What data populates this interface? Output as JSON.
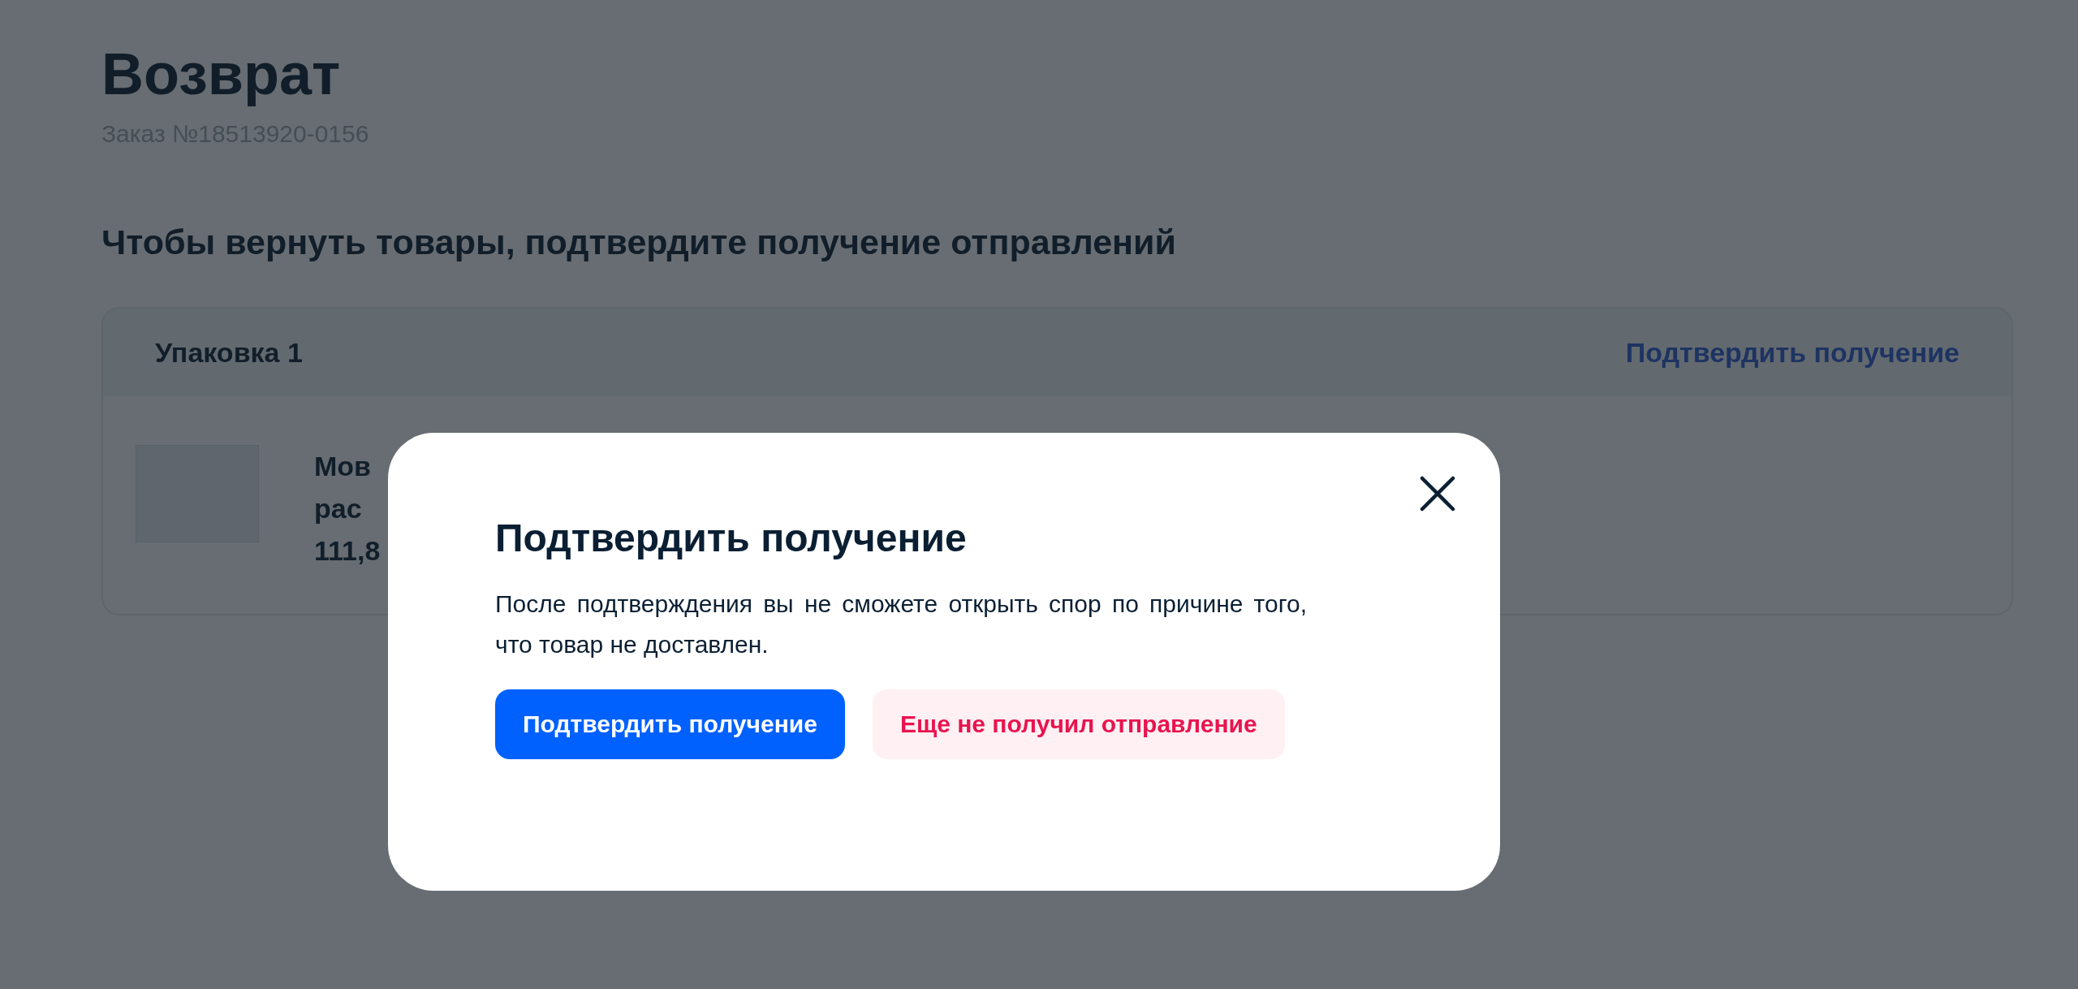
{
  "page": {
    "title": "Возврат",
    "order_number": "Заказ №18513920-0156",
    "subtitle": "Чтобы вернуть товары, подтвердите получение отправлений"
  },
  "package": {
    "title": "Упаковка 1",
    "action": "Подтвердить получение",
    "product": {
      "name_line_1": "Мов",
      "name_line_2": "рас",
      "price": "111,8"
    }
  },
  "modal": {
    "title": "Подтвердить получение",
    "text": "После подтверждения вы не сможете открыть спор по причине того, что товар не доставлен.",
    "buttons": [
      {
        "label": "Подтвердить получение",
        "kind": "primary"
      },
      {
        "label": "Еще не получил отправление",
        "kind": "danger"
      }
    ]
  }
}
